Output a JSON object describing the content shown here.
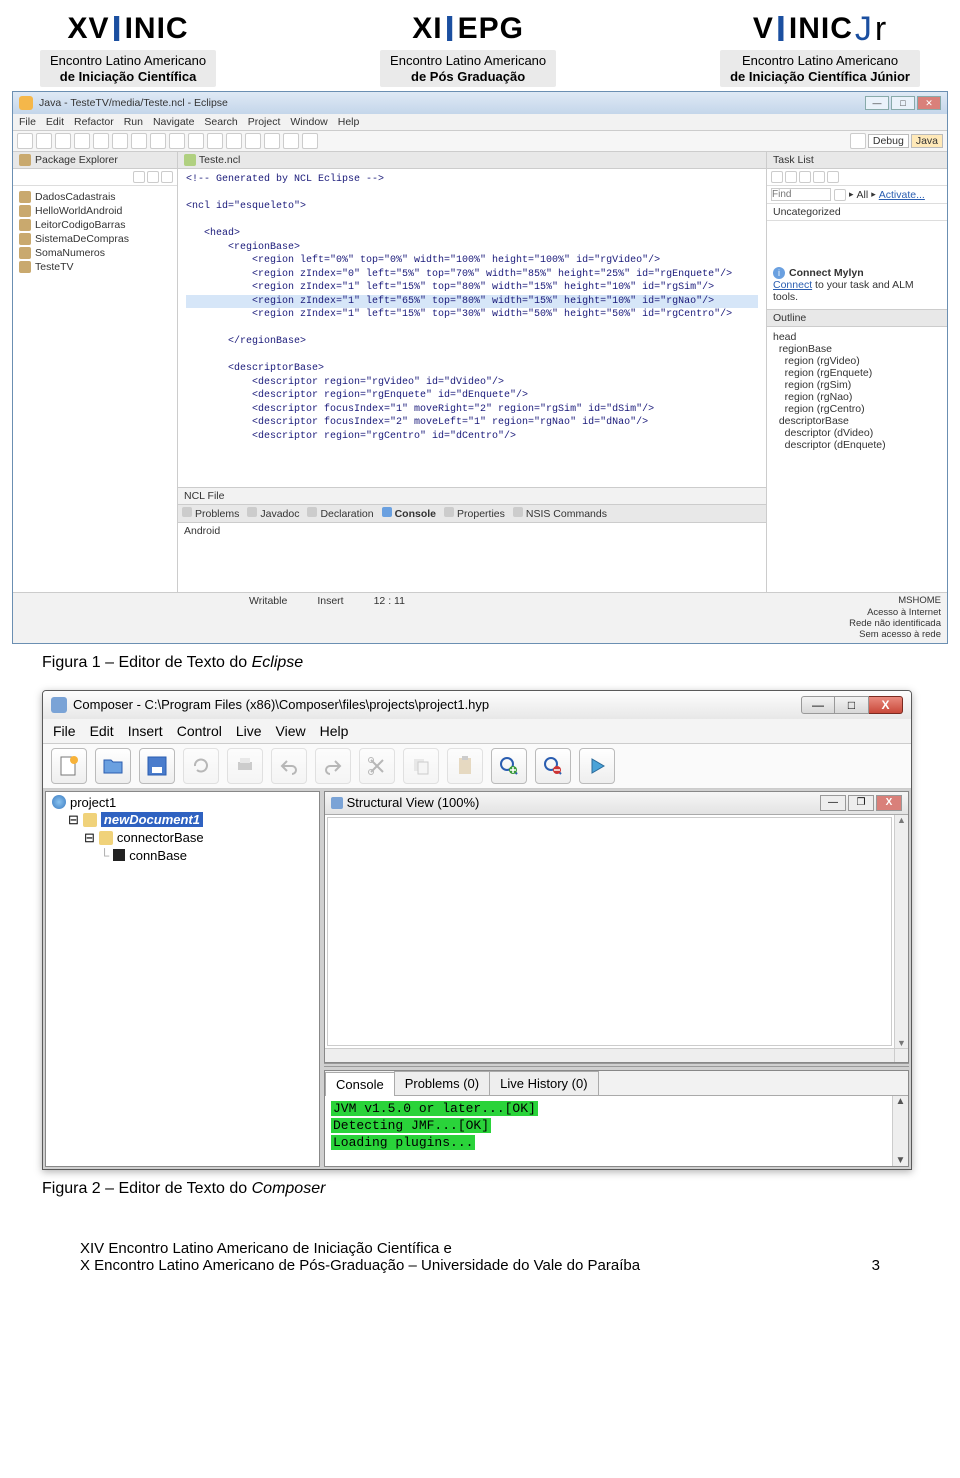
{
  "header_logos": [
    {
      "top_black_pre": "XV",
      "top_blue": "I",
      "top_black_post": "INIC",
      "sub_line1": "Encontro Latino Americano",
      "sub_line2": "de Iniciação Científica"
    },
    {
      "top_black_pre": "XI",
      "top_blue": "I",
      "top_black_post": "EPG",
      "sub_line1": "Encontro Latino Americano",
      "sub_line2": "de Pós Graduação"
    },
    {
      "top_black_pre": "V",
      "top_blue": "I",
      "top_black_post": "INIC",
      "suffix_blue": "J",
      "suffix_black": "r",
      "sub_line1": "Encontro Latino Americano",
      "sub_line2": "de Iniciação Científica Júnior"
    }
  ],
  "eclipse": {
    "title": "Java - TesteTV/media/Teste.ncl - Eclipse",
    "menus": [
      "File",
      "Edit",
      "Refactor",
      "Run",
      "Navigate",
      "Search",
      "Project",
      "Window",
      "Help"
    ],
    "perspective_debug": "Debug",
    "perspective_java": "Java",
    "package_explorer_label": "Package Explorer",
    "projects": [
      "DadosCadastrais",
      "HelloWorldAndroid",
      "LeitorCodigoBarras",
      "SistemaDeCompras",
      "SomaNumeros",
      "TesteTV"
    ],
    "editor_tab": "Teste.ncl",
    "code_lines": [
      "<!-- Generated by NCL Eclipse -->",
      "",
      "<ncl id=\"esqueleto\">",
      "",
      "   <head>",
      "       <regionBase>",
      "           <region left=\"0%\" top=\"0%\" width=\"100%\" height=\"100%\" id=\"rgVideo\"/>",
      "           <region zIndex=\"0\" left=\"5%\" top=\"70%\" width=\"85%\" height=\"25%\" id=\"rgEnquete\"/>",
      "           <region zIndex=\"1\" left=\"15%\" top=\"80%\" width=\"15%\" height=\"10%\" id=\"rgSim\"/>",
      "           <region zIndex=\"1\" left=\"65%\" top=\"80%\" width=\"15%\" height=\"10%\" id=\"rgNao\"/>",
      "           <region zIndex=\"1\" left=\"15%\" top=\"30%\" width=\"50%\" height=\"50%\" id=\"rgCentro\"/>",
      "",
      "       </regionBase>",
      "",
      "       <descriptorBase>",
      "           <descriptor region=\"rgVideo\" id=\"dVideo\"/>",
      "           <descriptor region=\"rgEnquete\" id=\"dEnquete\"/>",
      "           <descriptor focusIndex=\"1\" moveRight=\"2\" region=\"rgSim\" id=\"dSim\"/>",
      "           <descriptor focusIndex=\"2\" moveLeft=\"1\" region=\"rgNao\" id=\"dNao\"/>",
      "           <descriptor region=\"rgCentro\" id=\"dCentro\"/>"
    ],
    "highlight_line_index": 9,
    "ncl_file_tab": "NCL File",
    "bottom_tabs": [
      "Problems",
      "Javadoc",
      "Declaration",
      "Console",
      "Properties",
      "NSIS Commands"
    ],
    "bottom_active": "Console",
    "console_text": "Android",
    "task_list_label": "Task List",
    "find_placeholder": "Find",
    "all_label": "All",
    "activate_label": "Activate...",
    "uncategorized": "Uncategorized",
    "mylyn_title": "Connect Mylyn",
    "mylyn_link": "Connect",
    "mylyn_rest": " to your task and ALM tools.",
    "outline_label": "Outline",
    "outline_items": [
      "head",
      "  regionBase",
      "    region (rgVideo)",
      "    region (rgEnquete)",
      "    region (rgSim)",
      "    region (rgNao)",
      "    region (rgCentro)",
      "  descriptorBase",
      "    descriptor (dVideo)",
      "    descriptor (dEnquete)"
    ],
    "status_writable": "Writable",
    "status_insert": "Insert",
    "status_pos": "12 : 11",
    "status_net1": "MSHOME",
    "status_net2": "Acesso à Internet",
    "status_net3": "Rede não identificada",
    "status_net4": "Sem acesso à rede"
  },
  "caption1_pre": "Figura 1 – Editor de Texto do ",
  "caption1_em": "Eclipse",
  "composer": {
    "title": "Composer - C:\\Program Files (x86)\\Composer\\files\\projects\\project1.hyp",
    "menus": [
      "File",
      "Edit",
      "Insert",
      "Control",
      "Live",
      "View",
      "Help"
    ],
    "tree_root": "project1",
    "tree_doc": "newDocument1",
    "tree_conn_base": "connectorBase",
    "tree_conn": "connBase",
    "structural_title": "Structural View (100%)",
    "console_tabs": [
      "Console",
      "Problems (0)",
      "Live History (0)"
    ],
    "console_lines": [
      "JVM v1.5.0 or later...[OK]",
      "Detecting JMF...[OK]",
      "Loading plugins..."
    ]
  },
  "caption2_pre": "Figura 2 – Editor de Texto do ",
  "caption2_em": "Composer",
  "footer_line1": "XIV Encontro Latino Americano de Iniciação Científica e",
  "footer_line2": "X Encontro Latino Americano de Pós-Graduação – Universidade do Vale do Paraíba",
  "page_number": "3"
}
